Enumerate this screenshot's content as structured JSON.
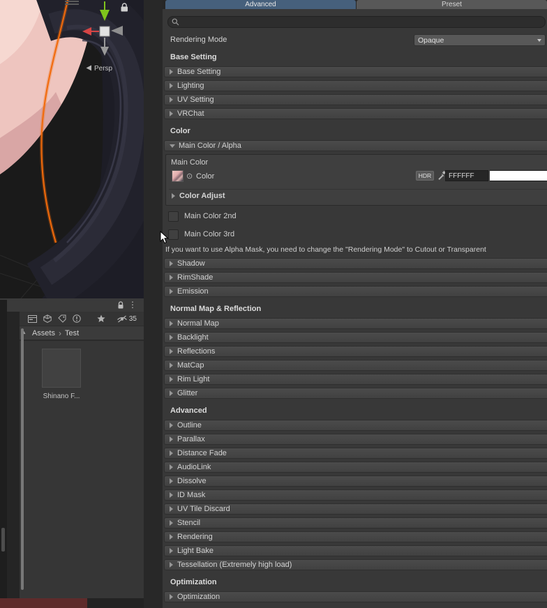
{
  "colors": {
    "tab_selected": "#46607c",
    "selection_outline": "#f26a0a",
    "status_bar_maroon": "#5e2b2b",
    "panel_background": "#383838"
  },
  "icons": {
    "kebab": "⋮",
    "object_picker": "⊙",
    "breadcrumb_arrow": "▲",
    "breadcrumb_separator": "›"
  },
  "scene": {
    "persp_label": "Persp"
  },
  "project": {
    "hidden_count": "35",
    "breadcrumb": {
      "root": "Assets",
      "current": "Test"
    },
    "items": [
      {
        "label": "Shinano F..."
      }
    ]
  },
  "inspector": {
    "tabs": {
      "advanced": "Advanced",
      "preset": "Preset"
    },
    "rendering_mode": {
      "label": "Rendering Mode",
      "value": "Opaque"
    },
    "groups": {
      "base": {
        "header": "Base Setting",
        "rows": [
          "Base Setting",
          "Lighting",
          "UV Setting",
          "VRChat"
        ]
      },
      "color": {
        "header": "Color",
        "main_row": "Main Color / Alpha",
        "box_title": "Main Color",
        "color_label": "Color",
        "hdr": "HDR",
        "hex": "FFFFFF",
        "adjust": "Color Adjust",
        "toggles": [
          "Main Color 2nd",
          "Main Color 3rd"
        ],
        "info": "If you want to use Alpha Mask, you need to change the \"Rendering Mode\" to Cutout or Transparent",
        "rows": [
          "Shadow",
          "RimShade",
          "Emission"
        ]
      },
      "normal": {
        "header": "Normal Map & Reflection",
        "rows": [
          "Normal Map",
          "Backlight",
          "Reflections",
          "MatCap",
          "Rim Light",
          "Glitter"
        ]
      },
      "advanced": {
        "header": "Advanced",
        "rows": [
          "Outline",
          "Parallax",
          "Distance Fade",
          "AudioLink",
          "Dissolve",
          "ID Mask",
          "UV Tile Discard",
          "Stencil",
          "Rendering",
          "Light Bake",
          "Tessellation (Extremely high load)"
        ]
      },
      "optimization": {
        "header": "Optimization",
        "rows": [
          "Optimization"
        ]
      }
    }
  }
}
